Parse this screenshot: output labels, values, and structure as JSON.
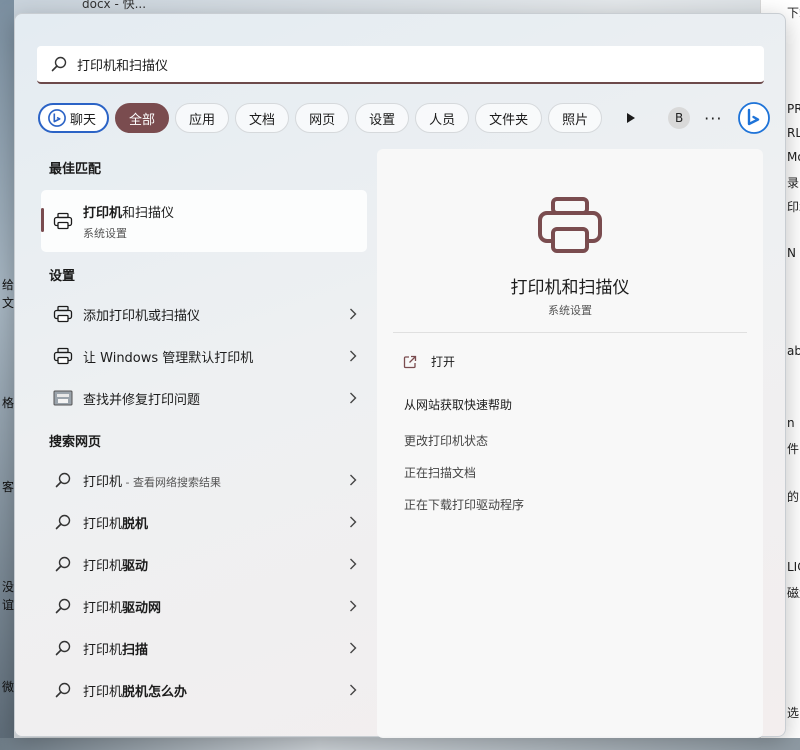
{
  "background": {
    "top_text": "docx - 快...",
    "right_fragments": [
      "下载",
      "PRE",
      "RL",
      "Mo",
      "录",
      "印木",
      "N",
      "ab",
      "n",
      "件",
      "的",
      "LIC",
      "磁盘",
      "选中"
    ],
    "left_fragments": [
      "给",
      "文",
      "格",
      "客",
      "没",
      "谊",
      "微"
    ]
  },
  "search": {
    "value": "打印机和扫描仪",
    "typed": "打印机",
    "suggestion": "和扫描仪"
  },
  "filters": {
    "chat_label": "聊天",
    "items": [
      "全部",
      "应用",
      "文档",
      "网页",
      "设置",
      "人员",
      "文件夹",
      "照片"
    ],
    "active": "全部",
    "avatar_letter": "B",
    "more": "···"
  },
  "results": {
    "best_match_heading": "最佳匹配",
    "best_match": {
      "title_bold": "打印机",
      "title_rest": "和扫描仪",
      "subtitle": "系统设置"
    },
    "settings_heading": "设置",
    "settings": [
      {
        "label": "添加打印机或扫描仪"
      },
      {
        "label": "让 Windows 管理默认打印机"
      },
      {
        "label": "查找并修复打印问题"
      }
    ],
    "web_heading": "搜索网页",
    "web": [
      {
        "prefix": "打印机",
        "bold": "",
        "sub": " - 查看网络搜索结果"
      },
      {
        "prefix": "打印机",
        "bold": "脱机",
        "sub": ""
      },
      {
        "prefix": "打印机",
        "bold": "驱动",
        "sub": ""
      },
      {
        "prefix": "打印机",
        "bold": "驱动网",
        "sub": ""
      },
      {
        "prefix": "打印机",
        "bold": "扫描",
        "sub": ""
      },
      {
        "prefix": "打印机",
        "bold": "脱机怎么办",
        "sub": ""
      }
    ]
  },
  "preview": {
    "title": "打印机和扫描仪",
    "subtitle": "系统设置",
    "open_label": "打开",
    "help_title": "从网站获取快速帮助",
    "links": [
      "更改打印机状态",
      "正在扫描文档",
      "正在下载打印驱动程序"
    ]
  },
  "colors": {
    "accent": "#7a4c4f",
    "chat_border": "#2b63c6"
  },
  "icons": {
    "search": "search-icon",
    "printer": "printer-icon",
    "troubleshoot": "troubleshoot-icon",
    "chevron": "chevron-right-icon",
    "external": "open-external-icon",
    "bing": "bing-icon",
    "play": "play-icon"
  }
}
